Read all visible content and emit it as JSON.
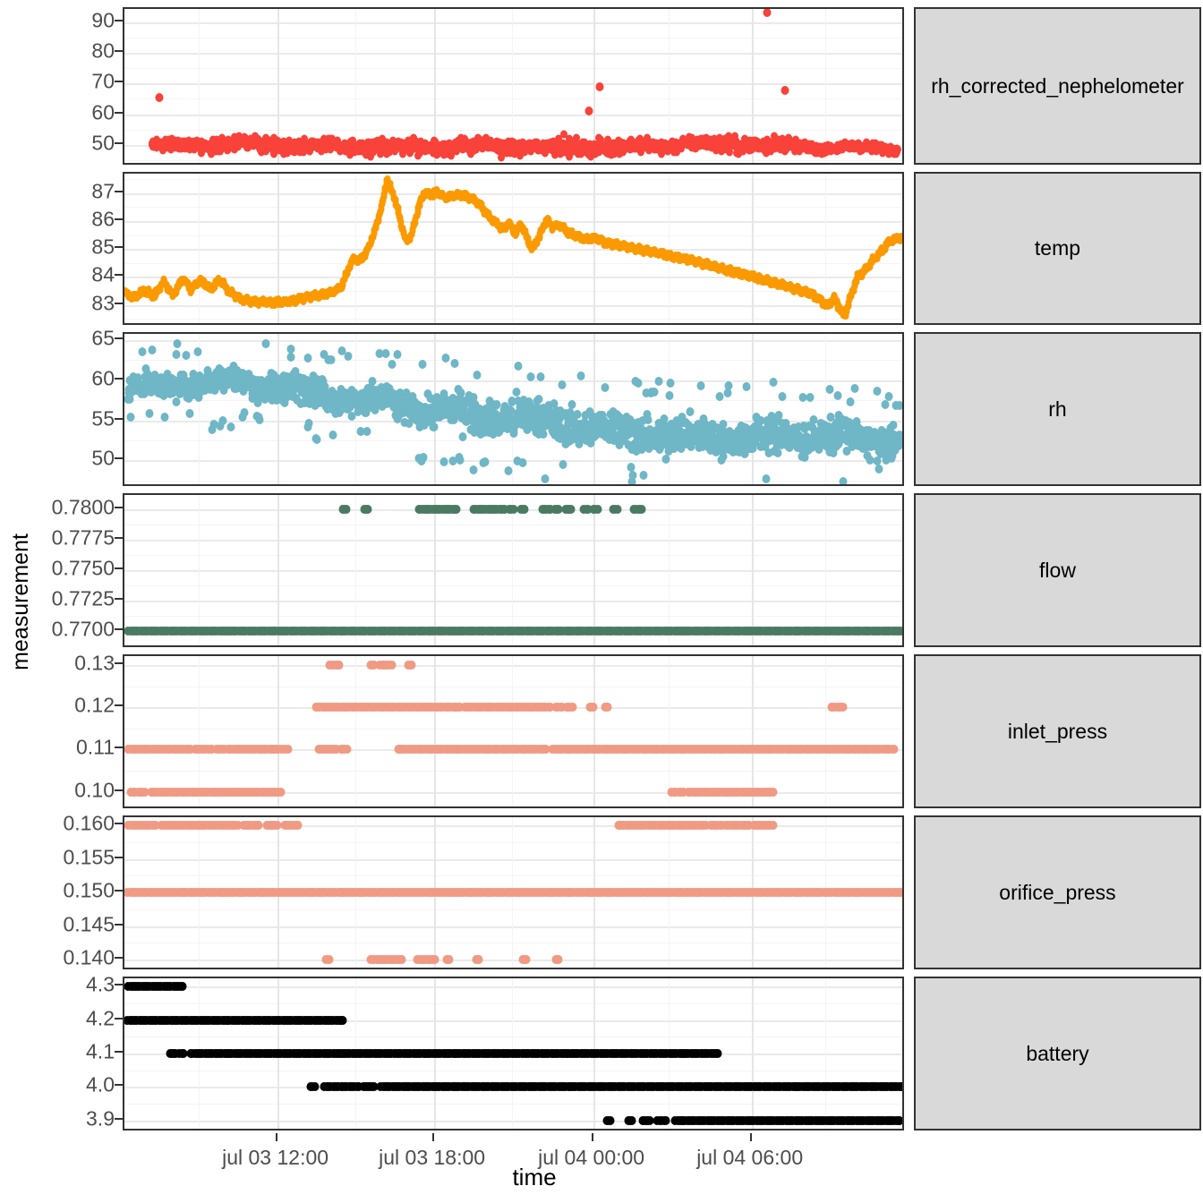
{
  "axis": {
    "y_title": "measurement",
    "x_title": "time",
    "x_ticks": [
      {
        "label": "jul 03 12:00",
        "pos": 0.1954
      },
      {
        "label": "jul 03 18:00",
        "pos": 0.3959
      },
      {
        "label": "jul 04 00:00",
        "pos": 0.5998
      },
      {
        "label": "jul 04 06:00",
        "pos": 0.8026
      }
    ]
  },
  "chart_data": {
    "type": "scatter",
    "title": "",
    "xlabel": "time",
    "ylabel": "measurement",
    "grid": true,
    "legend": "none",
    "facet_direction": "vertical",
    "x_axis": {
      "type": "datetime",
      "range": [
        "2023-07-03 08:40",
        "2023-07-04 07:40"
      ],
      "tick_labels": [
        "jul 03 12:00",
        "jul 03 18:00",
        "jul 04 00:00",
        "jul 04 06:00"
      ]
    },
    "panels": [
      {
        "name": "rh_corrected_nephelometer",
        "color": "#f8423a",
        "ylim": [
          44.0,
          94.5
        ],
        "yticks": [
          50,
          60,
          70,
          80,
          90
        ],
        "point_size": 7,
        "description": "dense noisy band near 48-52 with outliers at 65.5, 69, 67.8 and 93",
        "series": {
          "baseline": 49.5,
          "band": [
            46.5,
            53.0
          ],
          "outliers": [
            {
              "x": 0.045,
              "y": 65.5
            },
            {
              "x": 0.608,
              "y": 69.0
            },
            {
              "x": 0.594,
              "y": 61.0
            },
            {
              "x": 0.822,
              "y": 93.2
            },
            {
              "x": 0.845,
              "y": 67.8
            }
          ]
        }
      },
      {
        "name": "temp",
        "color": "#fb9a00",
        "ylim": [
          82.35,
          87.7
        ],
        "yticks": [
          83,
          84,
          85,
          86,
          87
        ],
        "point_size": 6,
        "description": "wiggly line: starts 83.5, dips 83.1, rises sharply to 87.5 peak, plateau 86.9, slow decline to 82.6, final rise to 85.4",
        "waypoints": [
          [
            0.0,
            83.45
          ],
          [
            0.012,
            83.25
          ],
          [
            0.025,
            83.55
          ],
          [
            0.038,
            83.3
          ],
          [
            0.05,
            83.85
          ],
          [
            0.062,
            83.35
          ],
          [
            0.075,
            83.95
          ],
          [
            0.085,
            83.55
          ],
          [
            0.098,
            83.9
          ],
          [
            0.11,
            83.55
          ],
          [
            0.122,
            83.9
          ],
          [
            0.135,
            83.45
          ],
          [
            0.15,
            83.2
          ],
          [
            0.17,
            83.1
          ],
          [
            0.195,
            83.1
          ],
          [
            0.215,
            83.15
          ],
          [
            0.235,
            83.3
          ],
          [
            0.25,
            83.35
          ],
          [
            0.265,
            83.45
          ],
          [
            0.278,
            83.65
          ],
          [
            0.288,
            84.4
          ],
          [
            0.295,
            84.7
          ],
          [
            0.3,
            84.55
          ],
          [
            0.31,
            84.9
          ],
          [
            0.32,
            85.6
          ],
          [
            0.33,
            86.6
          ],
          [
            0.336,
            87.5
          ],
          [
            0.345,
            86.9
          ],
          [
            0.353,
            86.05
          ],
          [
            0.36,
            85.3
          ],
          [
            0.367,
            85.45
          ],
          [
            0.375,
            86.35
          ],
          [
            0.383,
            87.0
          ],
          [
            0.392,
            86.95
          ],
          [
            0.4,
            87.05
          ],
          [
            0.41,
            86.85
          ],
          [
            0.42,
            86.9
          ],
          [
            0.432,
            86.95
          ],
          [
            0.445,
            86.8
          ],
          [
            0.455,
            86.6
          ],
          [
            0.465,
            86.2
          ],
          [
            0.475,
            85.95
          ],
          [
            0.485,
            85.7
          ],
          [
            0.492,
            85.95
          ],
          [
            0.5,
            85.55
          ],
          [
            0.508,
            85.9
          ],
          [
            0.515,
            85.4
          ],
          [
            0.522,
            85.0
          ],
          [
            0.53,
            85.4
          ],
          [
            0.54,
            86.05
          ],
          [
            0.548,
            85.8
          ],
          [
            0.558,
            85.85
          ],
          [
            0.568,
            85.6
          ],
          [
            0.58,
            85.45
          ],
          [
            0.592,
            85.35
          ],
          [
            0.605,
            85.4
          ],
          [
            0.618,
            85.2
          ],
          [
            0.632,
            85.15
          ],
          [
            0.648,
            85.05
          ],
          [
            0.665,
            84.95
          ],
          [
            0.685,
            84.85
          ],
          [
            0.705,
            84.7
          ],
          [
            0.725,
            84.6
          ],
          [
            0.745,
            84.45
          ],
          [
            0.765,
            84.3
          ],
          [
            0.785,
            84.15
          ],
          [
            0.805,
            84.0
          ],
          [
            0.825,
            83.85
          ],
          [
            0.845,
            83.7
          ],
          [
            0.862,
            83.55
          ],
          [
            0.878,
            83.4
          ],
          [
            0.89,
            83.2
          ],
          [
            0.9,
            82.95
          ],
          [
            0.908,
            83.25
          ],
          [
            0.915,
            82.9
          ],
          [
            0.922,
            82.6
          ],
          [
            0.93,
            83.35
          ],
          [
            0.938,
            84.0
          ],
          [
            0.948,
            84.25
          ],
          [
            0.958,
            84.6
          ],
          [
            0.968,
            84.9
          ],
          [
            0.98,
            85.3
          ],
          [
            0.992,
            85.4
          ],
          [
            1.0,
            85.3
          ]
        ]
      },
      {
        "name": "rh",
        "color": "#6fb6c6",
        "ylim": [
          47.0,
          65.8
        ],
        "yticks": [
          50,
          55,
          60,
          65
        ],
        "point_size": 8,
        "description": "noisy scatter declining from ~59 at start to ~52 at end, spread widening",
        "trend": [
          [
            0.0,
            58.8
          ],
          [
            0.15,
            59.6
          ],
          [
            0.3,
            58.0
          ],
          [
            0.45,
            55.5
          ],
          [
            0.6,
            54.0
          ],
          [
            0.75,
            53.2
          ],
          [
            0.9,
            52.6
          ],
          [
            1.0,
            52.0
          ]
        ],
        "spread": [
          [
            0.0,
            2.0
          ],
          [
            0.25,
            2.6
          ],
          [
            0.45,
            3.2
          ],
          [
            0.7,
            3.0
          ],
          [
            1.0,
            3.2
          ]
        ]
      },
      {
        "name": "flow",
        "color": "#4a7a62",
        "ylim": [
          0.7688,
          0.7812
        ],
        "yticks": [
          "0.7700",
          "0.7725",
          "0.7750",
          "0.7775",
          "0.7800"
        ],
        "ytick_values": [
          0.77,
          0.7725,
          0.775,
          0.7775,
          0.78
        ],
        "point_size": 8,
        "description": "two discrete levels: continuous 0.7700 across full range; sparse 0.7800 between ~0.28 and ~0.62",
        "levels": [
          {
            "value": 0.77,
            "segments": [
              [
                0.005,
                0.995
              ]
            ]
          },
          {
            "value": 0.78,
            "segments": [
              [
                0.28,
                0.284
              ],
              [
                0.307,
                0.312
              ],
              [
                0.377,
                0.425
              ],
              [
                0.447,
                0.487
              ],
              [
                0.492,
                0.498
              ],
              [
                0.507,
                0.512
              ],
              [
                0.535,
                0.545
              ],
              [
                0.551,
                0.556
              ],
              [
                0.565,
                0.572
              ],
              [
                0.588,
                0.593
              ],
              [
                0.6,
                0.606
              ],
              [
                0.625,
                0.631
              ],
              [
                0.652,
                0.662
              ]
            ]
          }
        ]
      },
      {
        "name": "inlet_press",
        "color": "#f09a84",
        "ylim": [
          0.0965,
          0.1322
        ],
        "yticks": [
          "0.10",
          "0.11",
          "0.12",
          "0.13"
        ],
        "ytick_values": [
          0.1,
          0.11,
          0.12,
          0.13
        ],
        "point_size": 8,
        "description": "discrete steps 0.10/0.11/0.12/0.13",
        "levels": [
          {
            "value": 0.13,
            "segments": [
              [
                0.262,
                0.275
              ],
              [
                0.315,
                0.32
              ],
              [
                0.327,
                0.342
              ],
              [
                0.363,
                0.368
              ]
            ]
          },
          {
            "value": 0.12,
            "segments": [
              [
                0.245,
                0.43
              ],
              [
                0.435,
                0.545
              ],
              [
                0.552,
                0.56
              ],
              [
                0.566,
                0.574
              ],
              [
                0.596,
                0.6
              ],
              [
                0.615,
                0.619
              ],
              [
                0.905,
                0.91
              ],
              [
                0.913,
                0.92
              ]
            ]
          },
          {
            "value": 0.11,
            "segments": [
              [
                0.005,
                0.085
              ],
              [
                0.09,
                0.112
              ],
              [
                0.118,
                0.128
              ],
              [
                0.133,
                0.2
              ],
              [
                0.204,
                0.21
              ],
              [
                0.248,
                0.272
              ],
              [
                0.277,
                0.285
              ],
              [
                0.35,
                0.54
              ],
              [
                0.548,
                0.985
              ]
            ]
          },
          {
            "value": 0.1,
            "segments": [
              [
                0.008,
                0.014
              ],
              [
                0.018,
                0.026
              ],
              [
                0.034,
                0.2
              ],
              [
                0.7,
                0.706
              ],
              [
                0.71,
                0.716
              ],
              [
                0.722,
                0.83
              ]
            ]
          }
        ]
      },
      {
        "name": "orifice_press",
        "color": "#f09a84",
        "ylim": [
          0.1388,
          0.1612
        ],
        "yticks": [
          "0.140",
          "0.145",
          "0.150",
          "0.155",
          "0.160"
        ],
        "ytick_values": [
          0.14,
          0.145,
          0.15,
          0.155,
          0.16
        ],
        "point_size": 8,
        "description": "mostly 0.150 continuous; 0.160 at start and near end; 0.140 sparse in middle",
        "levels": [
          {
            "value": 0.16,
            "segments": [
              [
                0.005,
                0.04
              ],
              [
                0.047,
                0.145
              ],
              [
                0.152,
                0.172
              ],
              [
                0.182,
                0.196
              ],
              [
                0.205,
                0.222
              ],
              [
                0.632,
                0.745
              ],
              [
                0.75,
                0.765
              ],
              [
                0.77,
                0.8
              ],
              [
                0.805,
                0.83
              ]
            ]
          },
          {
            "value": 0.15,
            "segments": [
              [
                0.004,
                0.996
              ]
            ]
          },
          {
            "value": 0.14,
            "segments": [
              [
                0.258,
                0.262
              ],
              [
                0.315,
                0.355
              ],
              [
                0.375,
                0.398
              ],
              [
                0.412,
                0.416
              ],
              [
                0.45,
                0.454
              ],
              [
                0.51,
                0.514
              ],
              [
                0.552,
                0.556
              ]
            ]
          }
        ]
      },
      {
        "name": "battery",
        "color": "#000000",
        "ylim": [
          3.875,
          4.325
        ],
        "yticks": [
          "3.9",
          "4.0",
          "4.1",
          "4.2",
          "4.3"
        ],
        "ytick_values": [
          3.9,
          4.0,
          4.1,
          4.2,
          4.3
        ],
        "point_size": 8,
        "description": "stepped decay 4.3 -> 3.9 over time",
        "levels": [
          {
            "value": 4.3,
            "segments": [
              [
                0.005,
                0.075
              ]
            ]
          },
          {
            "value": 4.2,
            "segments": [
              [
                0.004,
                0.28
              ]
            ]
          },
          {
            "value": 4.1,
            "segments": [
              [
                0.058,
                0.065
              ],
              [
                0.07,
                0.076
              ],
              [
                0.085,
                0.76
              ]
            ]
          },
          {
            "value": 4.0,
            "segments": [
              [
                0.238,
                0.244
              ],
              [
                0.256,
                0.3
              ],
              [
                0.306,
                0.32
              ],
              [
                0.328,
                0.994
              ]
            ]
          },
          {
            "value": 3.9,
            "segments": [
              [
                0.617,
                0.622
              ],
              [
                0.645,
                0.65
              ],
              [
                0.663,
                0.672
              ],
              [
                0.682,
                0.693
              ],
              [
                0.705,
                0.992
              ]
            ]
          }
        ]
      }
    ]
  }
}
